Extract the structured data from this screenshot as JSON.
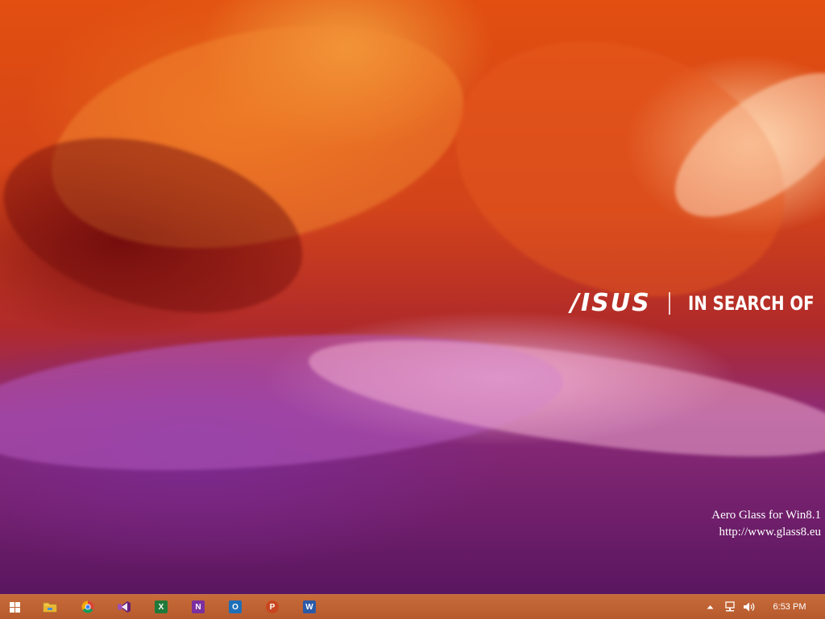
{
  "wallpaper": {
    "brand_logo": "/ISUS",
    "slogan": "IN SEARCH OF"
  },
  "watermark": {
    "line1": "Aero Glass for Win8.1",
    "line2": "http://www.glass8.eu"
  },
  "taskbar": {
    "start_icon": "windows-logo-icon",
    "apps": [
      {
        "name": "File Explorer",
        "icon": "folder-icon",
        "glyph": ""
      },
      {
        "name": "Google Chrome",
        "icon": "chrome-icon",
        "glyph": ""
      },
      {
        "name": "Visual Studio",
        "icon": "visual-studio-icon",
        "glyph": ""
      },
      {
        "name": "Excel",
        "icon": "excel-icon",
        "glyph": "X"
      },
      {
        "name": "OneNote",
        "icon": "onenote-icon",
        "glyph": "N"
      },
      {
        "name": "Outlook",
        "icon": "outlook-icon",
        "glyph": "O"
      },
      {
        "name": "PowerPoint",
        "icon": "powerpoint-icon",
        "glyph": "P"
      },
      {
        "name": "Word",
        "icon": "word-icon",
        "glyph": "W"
      }
    ],
    "tray": {
      "overflow_icon": "chevron-up-icon",
      "network_icon": "network-icon",
      "volume_icon": "volume-icon",
      "clock": "6:53 PM"
    }
  },
  "colors": {
    "taskbar": "#b65a2e",
    "excel": "#1f7a3a",
    "onenote": "#7b2fa0",
    "outlook": "#1e6fb8",
    "powerpoint": "#c8461f",
    "word": "#2b5aa8",
    "visual_studio": "#68217a"
  }
}
